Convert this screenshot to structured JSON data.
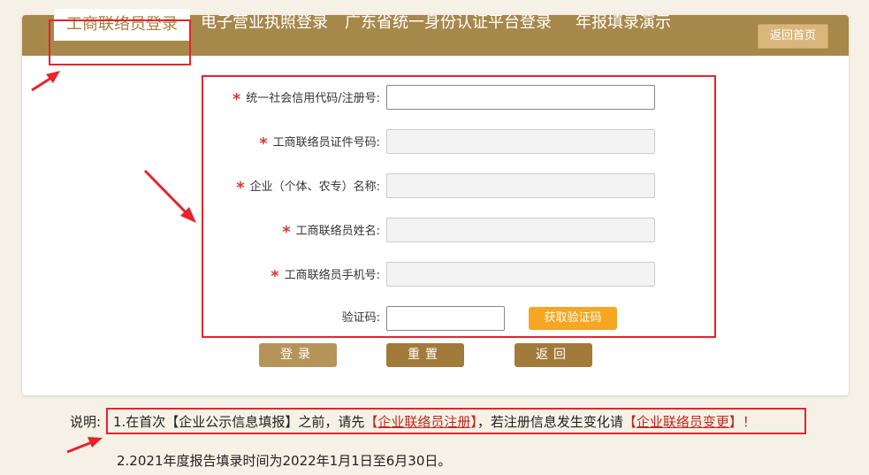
{
  "tabs": [
    {
      "label": "工商联络员登录",
      "active": true
    },
    {
      "label": "电子营业执照登录",
      "active": false
    },
    {
      "label": "广东省统一身份认证平台登录",
      "active": false
    },
    {
      "label": "年报填录演示",
      "active": false
    }
  ],
  "home_button": "返回首页",
  "form": {
    "credit_code_label": "统一社会信用代码/注册号:",
    "credit_code_value": "",
    "id_number_label": "工商联络员证件号码:",
    "id_number_value": "",
    "company_name_label": "企业（个体、农专）名称:",
    "company_name_value": "",
    "contact_name_label": "工商联络员姓名:",
    "contact_name_value": "",
    "phone_label": "工商联络员手机号:",
    "phone_value": "",
    "captcha_label": "验证码:",
    "captcha_value": "",
    "get_code_button": "获取验证码",
    "required_mark": "*"
  },
  "buttons": {
    "login": "登录",
    "reset": "重置",
    "back": "返回"
  },
  "notes": {
    "label": "说明:",
    "line1_prefix": "1.在首次【企业公示信息填报】之前，请先",
    "line1_link1": "企业联络员注册",
    "line1_middle": "，若注册信息发生变化请",
    "line1_link2": "企业联络员变更",
    "line1_suffix": "！",
    "line2": "2.2021年度报告填录时间为2022年1月1日至6月30日。"
  },
  "colors": {
    "tab_bar": "#a6884a",
    "annotation_red": "#e8232b",
    "link_red": "#c2271d",
    "orange_button": "#f5a623"
  }
}
